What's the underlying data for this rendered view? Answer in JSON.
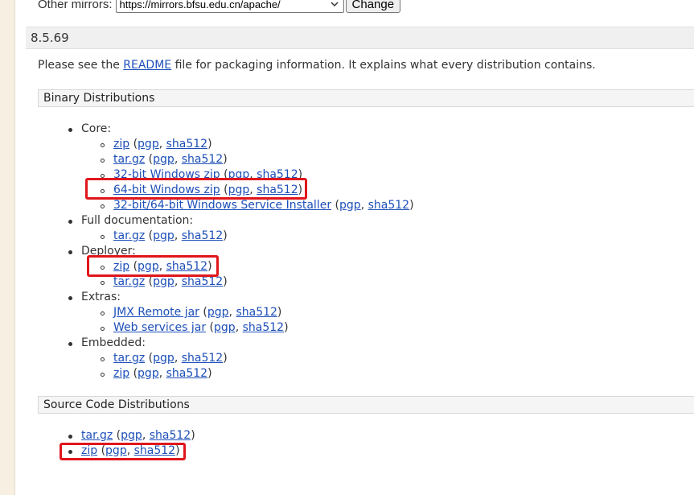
{
  "mirrors": {
    "label": "Other mirrors:",
    "selected": "https://mirrors.bfsu.edu.cn/apache/",
    "change_label": "Change"
  },
  "version": "8.5.69",
  "intro": {
    "before": "Please see the ",
    "link": "README",
    "after": " file for packaging information. It explains what every distribution contains."
  },
  "binary": {
    "heading": "Binary Distributions",
    "groups": [
      {
        "label": "Core:",
        "items": [
          {
            "link": "zip",
            "pgp": "pgp",
            "sha": "sha512"
          },
          {
            "link": "tar.gz",
            "pgp": "pgp",
            "sha": "sha512"
          },
          {
            "link": "32-bit Windows zip",
            "pgp": "pgp",
            "sha": "sha512"
          },
          {
            "link": "64-bit Windows zip",
            "pgp": "pgp",
            "sha": "sha512"
          },
          {
            "link": "32-bit/64-bit Windows Service Installer",
            "pgp": "pgp",
            "sha": "sha512"
          }
        ]
      },
      {
        "label": "Full documentation:",
        "items": [
          {
            "link": "tar.gz",
            "pgp": "pgp",
            "sha": "sha512"
          }
        ]
      },
      {
        "label": "Deployer:",
        "items": [
          {
            "link": "zip",
            "pgp": "pgp",
            "sha": "sha512"
          },
          {
            "link": "tar.gz",
            "pgp": "pgp",
            "sha": "sha512"
          }
        ]
      },
      {
        "label": "Extras:",
        "items": [
          {
            "link": "JMX Remote jar",
            "pgp": "pgp",
            "sha": "sha512"
          },
          {
            "link": "Web services jar",
            "pgp": "pgp",
            "sha": "sha512"
          }
        ]
      },
      {
        "label": "Embedded:",
        "items": [
          {
            "link": "tar.gz",
            "pgp": "pgp",
            "sha": "sha512"
          },
          {
            "link": "zip",
            "pgp": "pgp",
            "sha": "sha512"
          }
        ]
      }
    ]
  },
  "source": {
    "heading": "Source Code Distributions",
    "items": [
      {
        "link": "tar.gz",
        "pgp": "pgp",
        "sha": "sha512"
      },
      {
        "link": "zip",
        "pgp": "pgp",
        "sha": "sha512"
      }
    ]
  },
  "highlight_color": "#e0161b",
  "link_color": "#1d4fb8"
}
